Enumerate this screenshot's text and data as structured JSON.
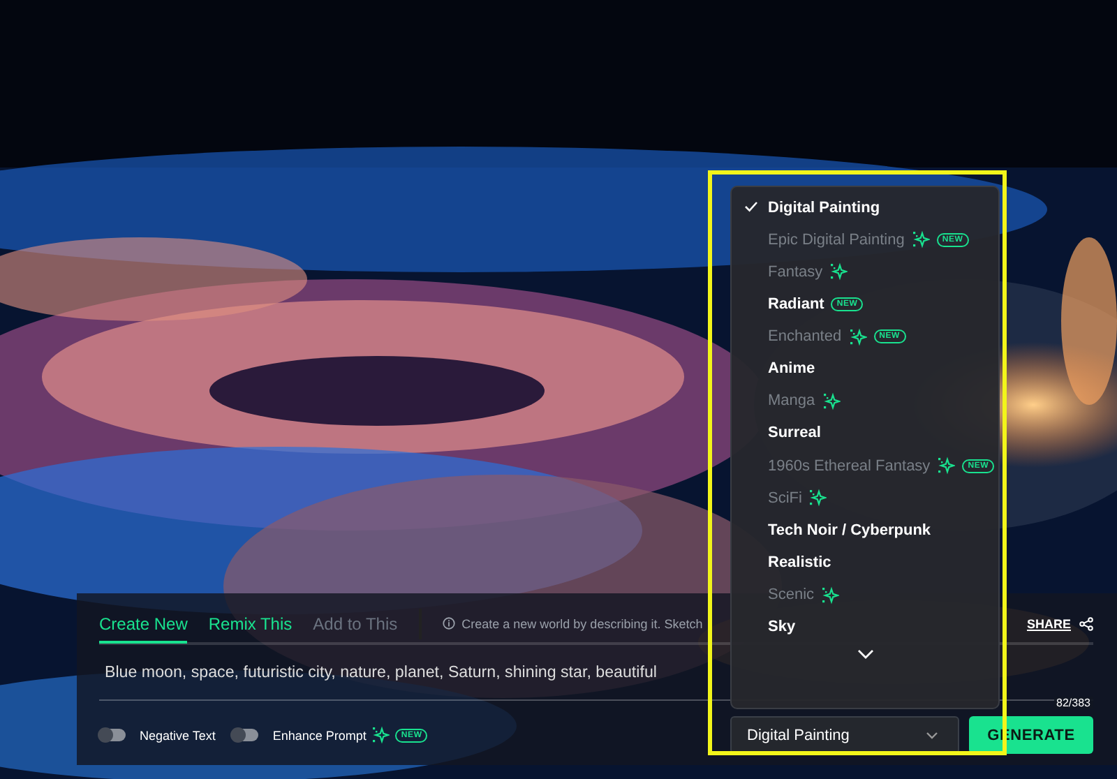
{
  "highlight_frame": true,
  "tabs": [
    {
      "label": "Create New",
      "selected": true,
      "disabled": false
    },
    {
      "label": "Remix This",
      "selected": false,
      "disabled": false
    },
    {
      "label": "Add to This",
      "selected": false,
      "disabled": true
    }
  ],
  "hint": "Create a new world by describing it. Sketch",
  "share": "SHARE",
  "prompt": {
    "value": "Blue moon, space, futuristic city, nature, planet, Saturn, shining star, beautiful",
    "counter": "82/383"
  },
  "toggles": [
    {
      "label": "Negative Text",
      "on": false,
      "sparkle": false
    },
    {
      "label": "Enhance Prompt",
      "on": false,
      "sparkle": true,
      "badge": "NEW"
    }
  ],
  "style_select": {
    "value": "Digital Painting"
  },
  "generate_button": "GENERATE",
  "style_menu": [
    {
      "label": "Digital Painting",
      "selected": true,
      "disabled": false,
      "sparkle": false
    },
    {
      "label": "Epic Digital Painting",
      "selected": false,
      "disabled": true,
      "sparkle": true,
      "badge": "NEW"
    },
    {
      "label": "Fantasy",
      "selected": false,
      "disabled": true,
      "sparkle": true
    },
    {
      "label": "Radiant",
      "selected": false,
      "disabled": false,
      "sparkle": false,
      "badge": "NEW"
    },
    {
      "label": "Enchanted",
      "selected": false,
      "disabled": true,
      "sparkle": true,
      "badge": "NEW"
    },
    {
      "label": "Anime",
      "selected": false,
      "disabled": false,
      "sparkle": false
    },
    {
      "label": "Manga",
      "selected": false,
      "disabled": true,
      "sparkle": true
    },
    {
      "label": "Surreal",
      "selected": false,
      "disabled": false,
      "sparkle": false
    },
    {
      "label": "1960s Ethereal Fantasy",
      "selected": false,
      "disabled": true,
      "sparkle": true,
      "badge": "NEW"
    },
    {
      "label": "SciFi",
      "selected": false,
      "disabled": true,
      "sparkle": true
    },
    {
      "label": "Tech Noir / Cyberpunk",
      "selected": false,
      "disabled": false,
      "sparkle": false
    },
    {
      "label": "Realistic",
      "selected": false,
      "disabled": false,
      "sparkle": false
    },
    {
      "label": "Scenic",
      "selected": false,
      "disabled": true,
      "sparkle": true
    },
    {
      "label": "Sky",
      "selected": false,
      "disabled": false,
      "sparkle": false
    }
  ]
}
